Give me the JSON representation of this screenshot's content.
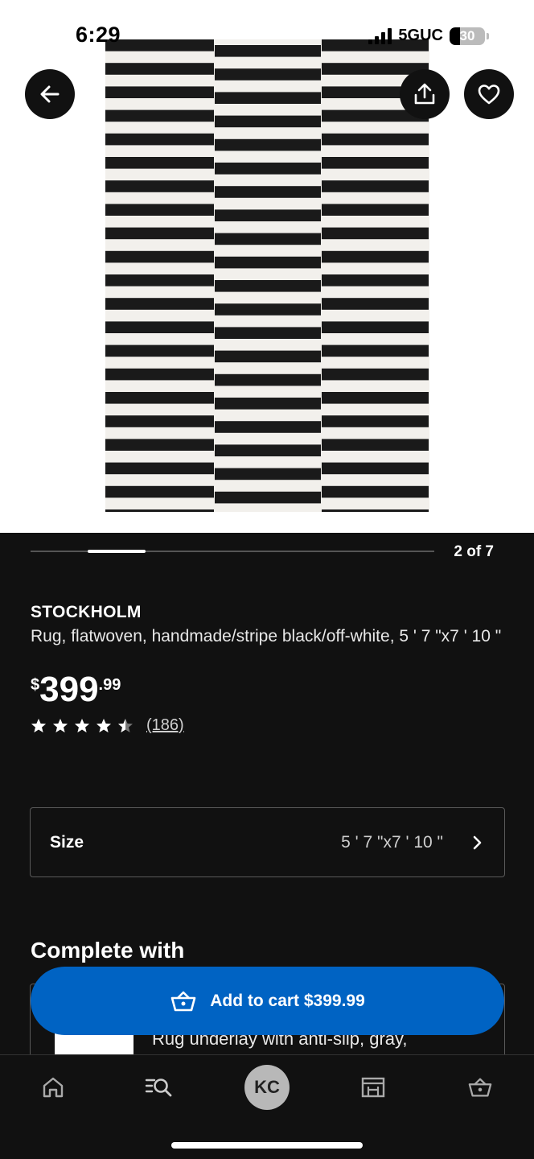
{
  "status_bar": {
    "time": "6:29",
    "network": "5GUC",
    "battery": "30",
    "battery_level": 0.3
  },
  "image_carousel": {
    "counter": "2 of 7",
    "current": 2,
    "total": 7
  },
  "product": {
    "name": "STOCKHOLM",
    "description": "Rug, flatwoven, handmade/stripe black/off-white, 5 ' 7 \"x7 ' 10 \"",
    "price_currency": "$",
    "price_integer": "399",
    "price_decimal": ".99",
    "rating": 4.5,
    "rating_count": "(186)"
  },
  "size_selector": {
    "label": "Size",
    "value": "5 ' 7 \"x7 ' 10 \""
  },
  "complete_with": {
    "title": "Complete with",
    "item_text": "Rug underlay with anti-slip, gray,"
  },
  "add_to_cart": {
    "label": "Add to cart $399.99"
  },
  "bottom_nav": {
    "avatar_initials": "KC",
    "items": [
      "home-icon",
      "search-icon",
      "avatar",
      "store-icon",
      "cart-icon"
    ]
  },
  "colors": {
    "background": "#111111",
    "accent_blue": "#0063c3",
    "rug_black": "#1a1a1a",
    "rug_white": "#f2f0ec"
  }
}
